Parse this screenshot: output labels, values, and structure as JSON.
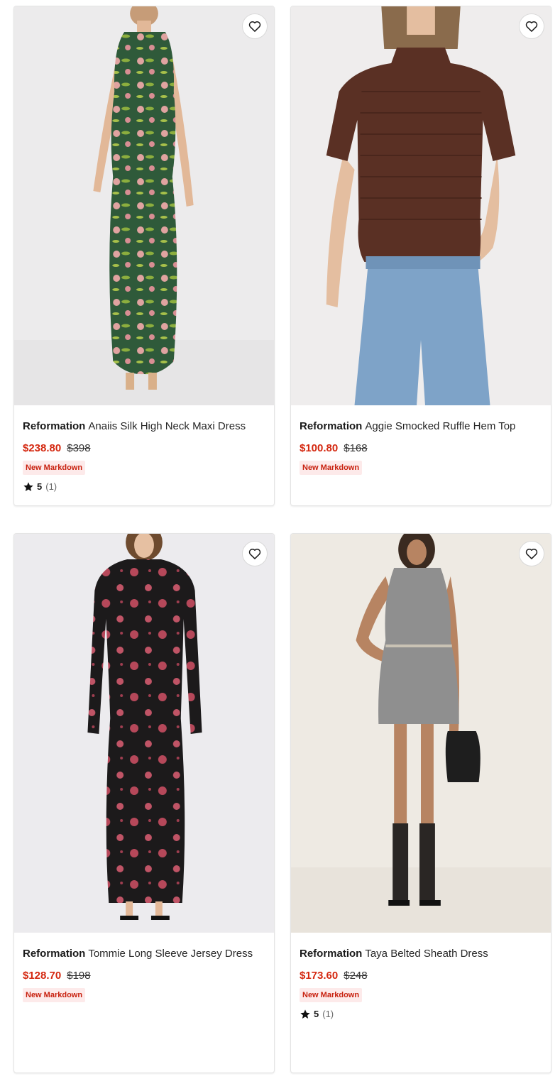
{
  "products": [
    {
      "brand": "Reformation",
      "name": "Anaiis Silk High Neck Maxi Dress",
      "sale_price": "$238.80",
      "original_price": "$398",
      "badge": "New Markdown",
      "rating": {
        "score": "5",
        "count": "(1)"
      },
      "image": "green floral silk maxi dress"
    },
    {
      "brand": "Reformation",
      "name": "Aggie Smocked Ruffle Hem Top",
      "sale_price": "$100.80",
      "original_price": "$168",
      "badge": "New Markdown",
      "image": "brown smocked puff-sleeve top with jeans"
    },
    {
      "brand": "Reformation",
      "name": "Tommie Long Sleeve Jersey Dress",
      "sale_price": "$128.70",
      "original_price": "$198",
      "badge": "New Markdown",
      "image": "black long sleeve jersey dress with pink floral print"
    },
    {
      "brand": "Reformation",
      "name": "Taya Belted Sheath Dress",
      "sale_price": "$173.60",
      "original_price": "$248",
      "badge": "New Markdown",
      "rating": {
        "score": "5",
        "count": "(1)"
      },
      "image": "grey belted sheath mini dress"
    }
  ],
  "icons": {
    "favorite": "heart-outline-icon",
    "rating": "star-icon"
  },
  "colors": {
    "sale": "#d4270f",
    "badge_bg": "#fdeaea",
    "badge_text": "#c8210f"
  }
}
